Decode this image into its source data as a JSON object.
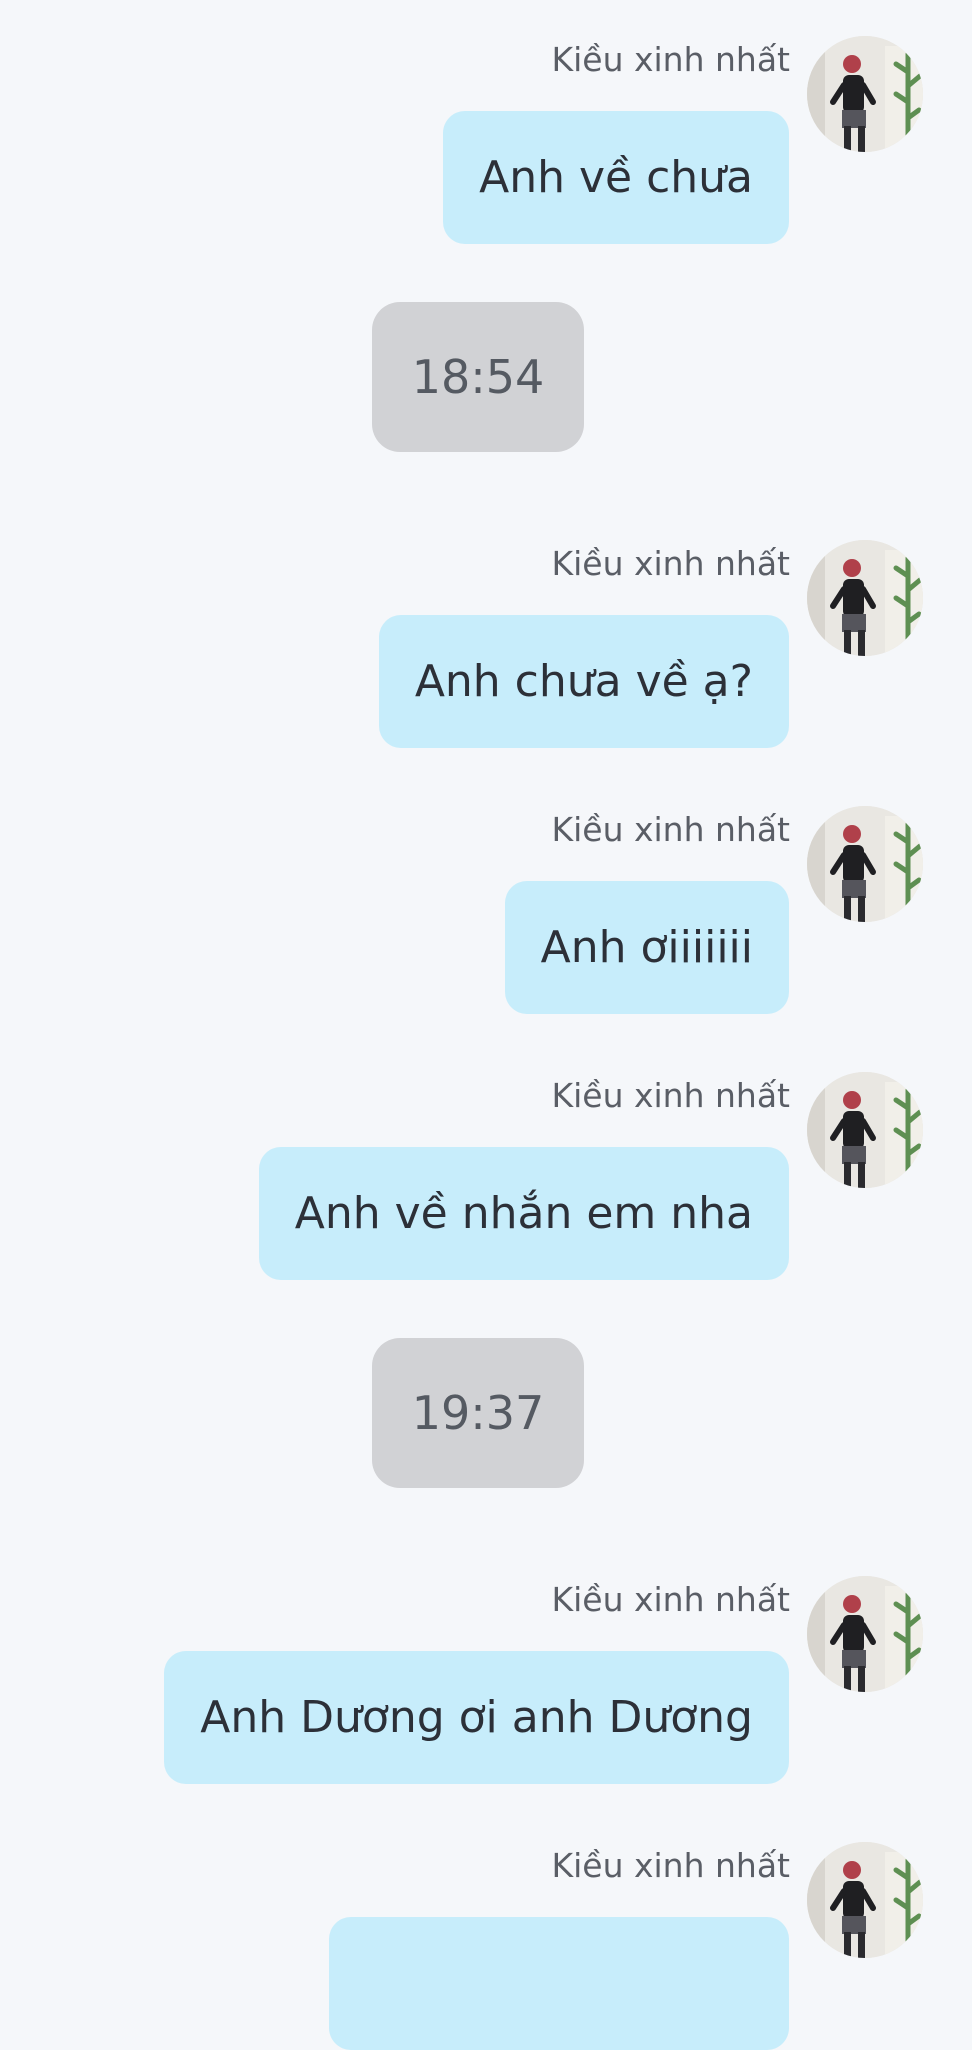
{
  "messages": [
    {
      "type": "message",
      "sender": "Kiều xinh nhất",
      "text": "Anh về chưa"
    },
    {
      "type": "time",
      "text": "18:54"
    },
    {
      "type": "message",
      "sender": "Kiều xinh nhất",
      "text": "Anh chưa về ạ?"
    },
    {
      "type": "message",
      "sender": "Kiều xinh nhất",
      "text": "Anh ơiiiiiii"
    },
    {
      "type": "message",
      "sender": "Kiều xinh nhất",
      "text": "Anh về nhắn em nha"
    },
    {
      "type": "time",
      "text": "19:37"
    },
    {
      "type": "message",
      "sender": "Kiều xinh nhất",
      "text": "Anh Dương ơi anh Dương"
    },
    {
      "type": "message",
      "sender": "Kiều xinh nhất",
      "text": ""
    }
  ],
  "colors": {
    "background": "#f5f7fa",
    "bubble": "#c7edfb",
    "time_pill": "#d1d2d5",
    "text": "#2c3038",
    "sender": "#5a5e66"
  },
  "icons": {
    "avatar": "avatar-photo"
  }
}
